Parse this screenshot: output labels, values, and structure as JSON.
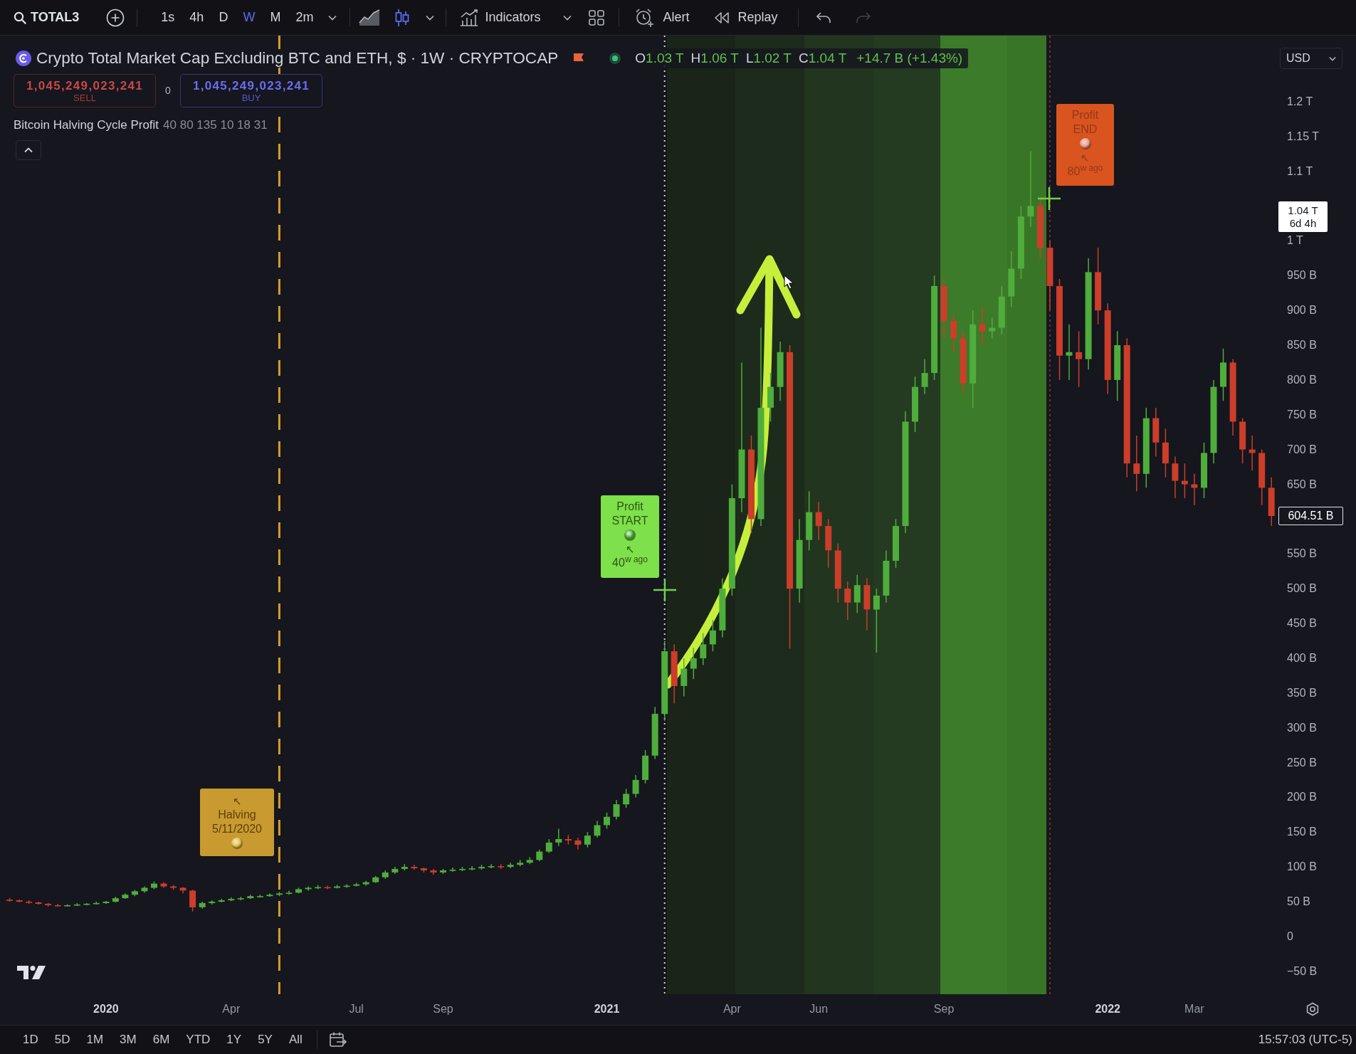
{
  "toolbar": {
    "symbol": "TOTAL3",
    "intervals": [
      {
        "label": "1s",
        "selected": false
      },
      {
        "label": "4h",
        "selected": false
      },
      {
        "label": "D",
        "selected": false
      },
      {
        "label": "W",
        "selected": true
      },
      {
        "label": "M",
        "selected": false
      },
      {
        "label": "2m",
        "selected": false
      }
    ],
    "chart_types": [
      {
        "kind": "area",
        "selected": false
      },
      {
        "kind": "candles",
        "selected": true
      }
    ],
    "indicators": "Indicators",
    "alert": "Alert",
    "replay": "Replay",
    "history": [
      {
        "kind": "undo",
        "disabled": false
      },
      {
        "kind": "redo",
        "disabled": true
      }
    ]
  },
  "legend": {
    "title": "Crypto Total Market Cap Excluding BTC and ETH, $ · 1W · CRYPTOCAP",
    "ohlc": [
      {
        "label": "O",
        "value": "1.03 T"
      },
      {
        "label": "H",
        "value": "1.06 T"
      },
      {
        "label": "L",
        "value": "1.02 T"
      },
      {
        "label": "C",
        "value": "1.04 T"
      }
    ],
    "change": "+14.7 B (+1.43%)",
    "sell": {
      "price": "1,045,249,023,241",
      "label": "SELL"
    },
    "spread": "0",
    "buy": {
      "price": "1,045,249,023,241",
      "label": "BUY"
    },
    "indicator": {
      "name": "Bitcoin Halving Cycle Profit",
      "params": "40 80 135 10 18 31"
    }
  },
  "markers": [
    {
      "kind": "halving",
      "arrow": "↖",
      "lines": [
        "Halving",
        "5/11/2020"
      ],
      "color": "#c99a2f"
    },
    {
      "kind": "profit_start",
      "lines": [
        "Profit",
        "START"
      ],
      "arrow": "↖",
      "ago": "40$^{w ago}$",
      "color": "#7ee04a"
    },
    {
      "kind": "profit_end",
      "lines": [
        "Profit",
        "END"
      ],
      "arrow": "↖",
      "ago": "80$^{w ago}$",
      "color": "#d9541f"
    }
  ],
  "chart": {
    "chart_data": {
      "type": "candlestick",
      "x": [
        "2019-10-28",
        "2019-11-04",
        "2019-11-11",
        "2019-11-18",
        "2019-11-25",
        "2019-12-02",
        "2019-12-09",
        "2019-12-16",
        "2019-12-23",
        "2019-12-30",
        "2020-01-06",
        "2020-01-13",
        "2020-01-20",
        "2020-01-27",
        "2020-02-03",
        "2020-02-10",
        "2020-02-17",
        "2020-02-24",
        "2020-03-02",
        "2020-03-09",
        "2020-03-16",
        "2020-03-23",
        "2020-03-30",
        "2020-04-06",
        "2020-04-13",
        "2020-04-20",
        "2020-04-27",
        "2020-05-04",
        "2020-05-11",
        "2020-05-18",
        "2020-05-25",
        "2020-06-01",
        "2020-06-08",
        "2020-06-15",
        "2020-06-22",
        "2020-06-29",
        "2020-07-06",
        "2020-07-13",
        "2020-07-20",
        "2020-07-27",
        "2020-08-03",
        "2020-08-10",
        "2020-08-17",
        "2020-08-24",
        "2020-08-31",
        "2020-09-07",
        "2020-09-14",
        "2020-09-21",
        "2020-09-28",
        "2020-10-05",
        "2020-10-12",
        "2020-10-19",
        "2020-10-26",
        "2020-11-02",
        "2020-11-09",
        "2020-11-16",
        "2020-11-23",
        "2020-11-30",
        "2020-12-07",
        "2020-12-14",
        "2020-12-21",
        "2020-12-28",
        "2021-01-04",
        "2021-01-11",
        "2021-01-18",
        "2021-01-25",
        "2021-02-01",
        "2021-02-08",
        "2021-02-15",
        "2021-02-22",
        "2021-03-01",
        "2021-03-08",
        "2021-03-15",
        "2021-03-22",
        "2021-03-29",
        "2021-04-05",
        "2021-04-12",
        "2021-04-19",
        "2021-04-26",
        "2021-05-03",
        "2021-05-10",
        "2021-05-17",
        "2021-05-24",
        "2021-05-31",
        "2021-06-07",
        "2021-06-14",
        "2021-06-21",
        "2021-06-28",
        "2021-07-05",
        "2021-07-12",
        "2021-07-19",
        "2021-07-26",
        "2021-08-02",
        "2021-08-09",
        "2021-08-16",
        "2021-08-23",
        "2021-08-30",
        "2021-09-06",
        "2021-09-13",
        "2021-09-20",
        "2021-09-27",
        "2021-10-04",
        "2021-10-11",
        "2021-10-18",
        "2021-10-25",
        "2021-11-01",
        "2021-11-08",
        "2021-11-15",
        "2021-11-22",
        "2021-11-29",
        "2021-12-06",
        "2021-12-13",
        "2021-12-20",
        "2021-12-27",
        "2022-01-03",
        "2022-01-10",
        "2022-01-17",
        "2022-01-24",
        "2022-01-31",
        "2022-02-07",
        "2022-02-14",
        "2022-02-21",
        "2022-02-28",
        "2022-03-07",
        "2022-03-14",
        "2022-03-21",
        "2022-03-28",
        "2022-04-04",
        "2022-04-11",
        "2022-04-18",
        "2022-04-25",
        "2022-05-02"
      ],
      "ohlc": [
        [
          53000000000.0,
          55000000000.0,
          50000000000.0,
          52000000000.0
        ],
        [
          52000000000.0,
          53000000000.0,
          49000000000.0,
          50000000000.0
        ],
        [
          50000000000.0,
          52000000000.0,
          47000000000.0,
          49000000000.0
        ],
        [
          49000000000.0,
          50000000000.0,
          46000000000.0,
          47000000000.0
        ],
        [
          47000000000.0,
          48000000000.0,
          43000000000.0,
          45000000000.0
        ],
        [
          45000000000.0,
          47000000000.0,
          43000000000.0,
          44000000000.0
        ],
        [
          44000000000.0,
          46000000000.0,
          43000000000.0,
          45000000000.0
        ],
        [
          45000000000.0,
          48000000000.0,
          44000000000.0,
          46000000000.0
        ],
        [
          46000000000.0,
          48000000000.0,
          45000000000.0,
          47000000000.0
        ],
        [
          47000000000.0,
          50000000000.0,
          46000000000.0,
          48000000000.0
        ],
        [
          48000000000.0,
          51000000000.0,
          47000000000.0,
          50000000000.0
        ],
        [
          50000000000.0,
          57000000000.0,
          49000000000.0,
          55000000000.0
        ],
        [
          55000000000.0,
          62000000000.0,
          54000000000.0,
          60000000000.0
        ],
        [
          60000000000.0,
          67000000000.0,
          58000000000.0,
          65000000000.0
        ],
        [
          65000000000.0,
          72000000000.0,
          63000000000.0,
          70000000000.0
        ],
        [
          70000000000.0,
          79000000000.0,
          68000000000.0,
          76000000000.0
        ],
        [
          76000000000.0,
          78000000000.0,
          70000000000.0,
          72000000000.0
        ],
        [
          72000000000.0,
          74000000000.0,
          67000000000.0,
          70000000000.0
        ],
        [
          70000000000.0,
          71000000000.0,
          62000000000.0,
          66000000000.0
        ],
        [
          66000000000.0,
          67000000000.0,
          36000000000.0,
          42000000000.0
        ],
        [
          42000000000.0,
          50000000000.0,
          40000000000.0,
          48000000000.0
        ],
        [
          48000000000.0,
          52000000000.0,
          46000000000.0,
          50000000000.0
        ],
        [
          50000000000.0,
          54000000000.0,
          49000000000.0,
          52000000000.0
        ],
        [
          52000000000.0,
          56000000000.0,
          51000000000.0,
          54000000000.0
        ],
        [
          54000000000.0,
          57000000000.0,
          52000000000.0,
          55000000000.0
        ],
        [
          55000000000.0,
          60000000000.0,
          54000000000.0,
          58000000000.0
        ],
        [
          58000000000.0,
          60000000000.0,
          56000000000.0,
          58000000000.0
        ],
        [
          58000000000.0,
          62000000000.0,
          57000000000.0,
          60000000000.0
        ],
        [
          60000000000.0,
          64000000000.0,
          58000000000.0,
          62000000000.0
        ],
        [
          62000000000.0,
          66000000000.0,
          60000000000.0,
          63000000000.0
        ],
        [
          63000000000.0,
          70000000000.0,
          62000000000.0,
          68000000000.0
        ],
        [
          68000000000.0,
          72000000000.0,
          66000000000.0,
          70000000000.0
        ],
        [
          70000000000.0,
          74000000000.0,
          68000000000.0,
          71000000000.0
        ],
        [
          71000000000.0,
          73000000000.0,
          68000000000.0,
          70000000000.0
        ],
        [
          70000000000.0,
          74000000000.0,
          69000000000.0,
          72000000000.0
        ],
        [
          72000000000.0,
          75000000000.0,
          70000000000.0,
          73000000000.0
        ],
        [
          73000000000.0,
          77000000000.0,
          72000000000.0,
          75000000000.0
        ],
        [
          75000000000.0,
          80000000000.0,
          73000000000.0,
          78000000000.0
        ],
        [
          78000000000.0,
          87000000000.0,
          77000000000.0,
          85000000000.0
        ],
        [
          85000000000.0,
          95000000000.0,
          83000000000.0,
          92000000000.0
        ],
        [
          92000000000.0,
          100000000000.0,
          90000000000.0,
          97000000000.0
        ],
        [
          97000000000.0,
          104000000000.0,
          95000000000.0,
          100000000000.0
        ],
        [
          100000000000.0,
          103000000000.0,
          96000000000.0,
          98000000000.0
        ],
        [
          98000000000.0,
          99000000000.0,
          92000000000.0,
          95000000000.0
        ],
        [
          95000000000.0,
          97000000000.0,
          89000000000.0,
          92000000000.0
        ],
        [
          92000000000.0,
          97000000000.0,
          90000000000.0,
          95000000000.0
        ],
        [
          95000000000.0,
          99000000000.0,
          93000000000.0,
          96000000000.0
        ],
        [
          96000000000.0,
          100000000000.0,
          94000000000.0,
          97000000000.0
        ],
        [
          97000000000.0,
          101000000000.0,
          95000000000.0,
          98000000000.0
        ],
        [
          98000000000.0,
          103000000000.0,
          96000000000.0,
          100000000000.0
        ],
        [
          100000000000.0,
          104000000000.0,
          98000000000.0,
          101000000000.0
        ],
        [
          101000000000.0,
          104000000000.0,
          97000000000.0,
          100000000000.0
        ],
        [
          100000000000.0,
          106000000000.0,
          98000000000.0,
          103000000000.0
        ],
        [
          103000000000.0,
          110000000000.0,
          101000000000.0,
          106000000000.0
        ],
        [
          106000000000.0,
          114000000000.0,
          104000000000.0,
          110000000000.0
        ],
        [
          110000000000.0,
          125000000000.0,
          108000000000.0,
          122000000000.0
        ],
        [
          122000000000.0,
          140000000000.0,
          120000000000.0,
          135000000000.0
        ],
        [
          135000000000.0,
          155000000000.0,
          130000000000.0,
          140000000000.0
        ],
        [
          140000000000.0,
          146000000000.0,
          132000000000.0,
          138000000000.0
        ],
        [
          138000000000.0,
          142000000000.0,
          125000000000.0,
          132000000000.0
        ],
        [
          132000000000.0,
          150000000000.0,
          128000000000.0,
          145000000000.0
        ],
        [
          145000000000.0,
          166000000000.0,
          142000000000.0,
          160000000000.0
        ],
        [
          160000000000.0,
          178000000000.0,
          155000000000.0,
          172000000000.0
        ],
        [
          172000000000.0,
          196000000000.0,
          168000000000.0,
          190000000000.0
        ],
        [
          190000000000.0,
          212000000000.0,
          185000000000.0,
          205000000000.0
        ],
        [
          205000000000.0,
          232000000000.0,
          200000000000.0,
          225000000000.0
        ],
        [
          225000000000.0,
          268000000000.0,
          220000000000.0,
          260000000000.0
        ],
        [
          260000000000.0,
          330000000000.0,
          255000000000.0,
          320000000000.0
        ],
        [
          320000000000.0,
          425000000000.0,
          310000000000.0,
          410000000000.0
        ],
        [
          410000000000.0,
          420000000000.0,
          335000000000.0,
          360000000000.0
        ],
        [
          360000000000.0,
          400000000000.0,
          345000000000.0,
          385000000000.0
        ],
        [
          385000000000.0,
          415000000000.0,
          370000000000.0,
          400000000000.0
        ],
        [
          400000000000.0,
          436000000000.0,
          390000000000.0,
          420000000000.0
        ],
        [
          420000000000.0,
          455000000000.0,
          410000000000.0,
          440000000000.0
        ],
        [
          440000000000.0,
          515000000000.0,
          430000000000.0,
          500000000000.0
        ],
        [
          500000000000.0,
          650000000000.0,
          490000000000.0,
          630000000000.0
        ],
        [
          630000000000.0,
          825000000000.0,
          610000000000.0,
          700000000000.0
        ],
        [
          700000000000.0,
          720000000000.0,
          580000000000.0,
          600000000000.0
        ],
        [
          600000000000.0,
          875000000000.0,
          590000000000.0,
          760000000000.0
        ],
        [
          760000000000.0,
          810000000000.0,
          740000000000.0,
          790000000000.0
        ],
        [
          790000000000.0,
          855000000000.0,
          770000000000.0,
          840000000000.0
        ],
        [
          840000000000.0,
          850000000000.0,
          414000000000.0,
          500000000000.0
        ],
        [
          500000000000.0,
          600000000000.0,
          480000000000.0,
          570000000000.0
        ],
        [
          570000000000.0,
          640000000000.0,
          555000000000.0,
          610000000000.0
        ],
        [
          610000000000.0,
          625000000000.0,
          570000000000.0,
          590000000000.0
        ],
        [
          590000000000.0,
          600000000000.0,
          530000000000.0,
          555000000000.0
        ],
        [
          555000000000.0,
          565000000000.0,
          480000000000.0,
          500000000000.0
        ],
        [
          500000000000.0,
          510000000000.0,
          455000000000.0,
          480000000000.0
        ],
        [
          480000000000.0,
          520000000000.0,
          465000000000.0,
          505000000000.0
        ],
        [
          505000000000.0,
          515000000000.0,
          440000000000.0,
          470000000000.0
        ],
        [
          470000000000.0,
          500000000000.0,
          408000000000.0,
          490000000000.0
        ],
        [
          490000000000.0,
          555000000000.0,
          480000000000.0,
          540000000000.0
        ],
        [
          540000000000.0,
          600000000000.0,
          530000000000.0,
          590000000000.0
        ],
        [
          590000000000.0,
          755000000000.0,
          580000000000.0,
          740000000000.0
        ],
        [
          740000000000.0,
          805000000000.0,
          725000000000.0,
          790000000000.0
        ],
        [
          790000000000.0,
          830000000000.0,
          780000000000.0,
          810000000000.0
        ],
        [
          810000000000.0,
          950000000000.0,
          800000000000.0,
          935000000000.0
        ],
        [
          935000000000.0,
          945000000000.0,
          860000000000.0,
          885000000000.0
        ],
        [
          885000000000.0,
          895000000000.0,
          840000000000.0,
          860000000000.0
        ],
        [
          860000000000.0,
          870000000000.0,
          780000000000.0,
          795000000000.0
        ],
        [
          795000000000.0,
          900000000000.0,
          760000000000.0,
          880000000000.0
        ],
        [
          880000000000.0,
          905000000000.0,
          850000000000.0,
          870000000000.0
        ],
        [
          870000000000.0,
          890000000000.0,
          860000000000.0,
          875000000000.0
        ],
        [
          875000000000.0,
          935000000000.0,
          865000000000.0,
          920000000000.0
        ],
        [
          920000000000.0,
          985000000000.0,
          905000000000.0,
          960000000000.0
        ],
        [
          960000000000.0,
          1050000000000.0,
          945000000000.0,
          1035000000000.0
        ],
        [
          1035000000000.0,
          1129000000000.0,
          1020000000000.0,
          1050000000000.0
        ],
        [
          1050000000000.0,
          1060000000000.0,
          975000000000.0,
          990000000000.0
        ],
        [
          990000000000.0,
          1000000000000.0,
          900000000000.0,
          935000000000.0
        ],
        [
          935000000000.0,
          945000000000.0,
          800000000000.0,
          835000000000.0
        ],
        [
          835000000000.0,
          880000000000.0,
          800000000000.0,
          840000000000.0
        ],
        [
          840000000000.0,
          870000000000.0,
          790000000000.0,
          830000000000.0
        ],
        [
          830000000000.0,
          975000000000.0,
          815000000000.0,
          955000000000.0
        ],
        [
          955000000000.0,
          990000000000.0,
          880000000000.0,
          900000000000.0
        ],
        [
          900000000000.0,
          910000000000.0,
          780000000000.0,
          800000000000.0
        ],
        [
          800000000000.0,
          870000000000.0,
          770000000000.0,
          850000000000.0
        ],
        [
          850000000000.0,
          860000000000.0,
          660000000000.0,
          680000000000.0
        ],
        [
          680000000000.0,
          720000000000.0,
          640000000000.0,
          665000000000.0
        ],
        [
          665000000000.0,
          760000000000.0,
          645000000000.0,
          745000000000.0
        ],
        [
          745000000000.0,
          760000000000.0,
          690000000000.0,
          710000000000.0
        ],
        [
          710000000000.0,
          730000000000.0,
          660000000000.0,
          680000000000.0
        ],
        [
          680000000000.0,
          690000000000.0,
          630000000000.0,
          655000000000.0
        ],
        [
          655000000000.0,
          680000000000.0,
          630000000000.0,
          650000000000.0
        ],
        [
          650000000000.0,
          665000000000.0,
          620000000000.0,
          645000000000.0
        ],
        [
          645000000000.0,
          710000000000.0,
          630000000000.0,
          695000000000.0
        ],
        [
          695000000000.0,
          800000000000.0,
          680000000000.0,
          790000000000.0
        ],
        [
          790000000000.0,
          845000000000.0,
          770000000000.0,
          825000000000.0
        ],
        [
          825000000000.0,
          830000000000.0,
          720000000000.0,
          740000000000.0
        ],
        [
          740000000000.0,
          745000000000.0,
          680000000000.0,
          700000000000.0
        ],
        [
          700000000000.0,
          720000000000.0,
          670000000000.0,
          695000000000.0
        ],
        [
          695000000000.0,
          700000000000.0,
          620000000000.0,
          645000000000.0
        ],
        [
          645000000000.0,
          660000000000.0,
          590000000000.0,
          604510000000.0
        ]
      ],
      "xlim": [
        "2019-10-21",
        "2022-05-05"
      ],
      "ylim": [
        -83000000000.0,
        1295000000000.0
      ],
      "yticks": [
        {
          "value": 1200000000000.0,
          "label": "1.2 T"
        },
        {
          "value": 1150000000000.0,
          "label": "1.15 T"
        },
        {
          "value": 1100000000000.0,
          "label": "1.1 T"
        },
        {
          "value": 1000000000000.0,
          "label": "1 T"
        },
        {
          "value": 950000000000.0,
          "label": "950 B"
        },
        {
          "value": 900000000000.0,
          "label": "900 B"
        },
        {
          "value": 850000000000.0,
          "label": "850 B"
        },
        {
          "value": 800000000000.0,
          "label": "800 B"
        },
        {
          "value": 750000000000.0,
          "label": "750 B"
        },
        {
          "value": 700000000000.0,
          "label": "700 B"
        },
        {
          "value": 650000000000.0,
          "label": "650 B"
        },
        {
          "value": 550000000000.0,
          "label": "550 B"
        },
        {
          "value": 500000000000.0,
          "label": "500 B"
        },
        {
          "value": 450000000000.0,
          "label": "450 B"
        },
        {
          "value": 400000000000.0,
          "label": "400 B"
        },
        {
          "value": 350000000000.0,
          "label": "350 B"
        },
        {
          "value": 300000000000.0,
          "label": "300 B"
        },
        {
          "value": 250000000000.0,
          "label": "250 B"
        },
        {
          "value": 200000000000.0,
          "label": "200 B"
        },
        {
          "value": 150000000000.0,
          "label": "150 B"
        },
        {
          "value": 100000000000.0,
          "label": "100 B"
        },
        {
          "value": 50000000000.0,
          "label": "50 B"
        },
        {
          "value": 0,
          "label": "0"
        },
        {
          "value": -50000000000.0,
          "label": "−50 B"
        }
      ],
      "xticks": [
        {
          "value": "2020-01-06",
          "label": "2020"
        },
        {
          "value": "2020-04-06",
          "label": "Apr"
        },
        {
          "value": "2020-07-06",
          "label": "Jul"
        },
        {
          "value": "2020-09-07",
          "label": "Sep"
        },
        {
          "value": "2021-01-04",
          "label": "2021"
        },
        {
          "value": "2021-04-05",
          "label": "Apr"
        },
        {
          "value": "2021-06-07",
          "label": "Jun"
        },
        {
          "value": "2021-09-06",
          "label": "Sep"
        },
        {
          "value": "2022-01-03",
          "label": "2022"
        },
        {
          "value": "2022-03-07",
          "label": "Mar"
        }
      ],
      "ref_lines": [
        {
          "axis": "x",
          "value": "2020-05-11",
          "color": "#d59f2d"
        },
        {
          "axis": "x",
          "value": "2021-02-15",
          "color": "#d8d8d8"
        },
        {
          "axis": "x",
          "value": "2021-11-22",
          "color": "#7a2c2c"
        }
      ]
    }
  },
  "price_axis": {
    "currency": "USD",
    "last_price": {
      "value": "1.04 T",
      "countdown": "6d 4h"
    },
    "price_tag": "604.51 B"
  },
  "bottom_bar": {
    "ranges": [
      "1D",
      "5D",
      "1M",
      "3M",
      "6M",
      "YTD",
      "1Y",
      "5Y",
      "All"
    ],
    "clock": "15:57:03 (UTC-5)"
  }
}
